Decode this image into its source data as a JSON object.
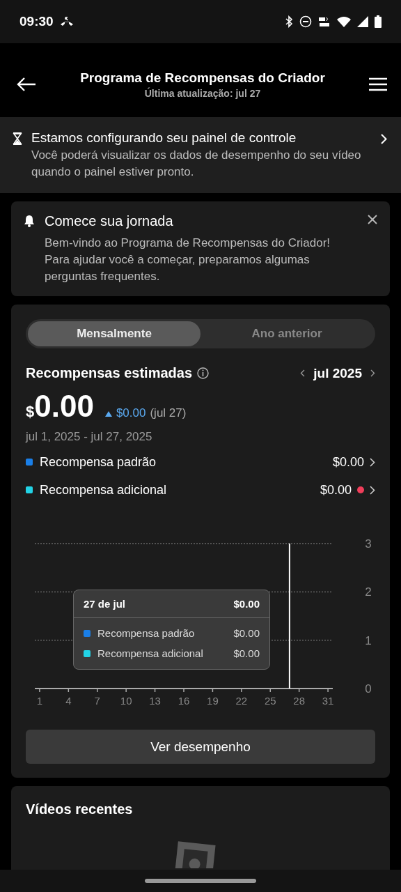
{
  "status_bar": {
    "time": "09:30"
  },
  "header": {
    "title": "Programa de Recompensas do Criador",
    "subtitle": "Última atualização: jul 27"
  },
  "setup_banner": {
    "title": "Estamos configurando seu painel de controle",
    "text": "Você poderá visualizar os dados de desempenho do seu vídeo quando o painel estiver pronto."
  },
  "journey_card": {
    "title": "Comece sua jornada",
    "text": "Bem-vindo ao Programa de Recompensas do Criador! Para ajudar você a começar, preparamos algumas perguntas frequentes."
  },
  "rewards": {
    "tabs": [
      {
        "label": "Mensalmente",
        "selected": true
      },
      {
        "label": "Ano anterior",
        "selected": false
      }
    ],
    "title": "Recompensas estimadas",
    "month": "jul 2025",
    "currency": "$",
    "amount": "0.00",
    "change": "$0.00",
    "change_date": "(jul 27)",
    "range": "jul 1, 2025 - jul 27, 2025",
    "breakdown": [
      {
        "label": "Recompensa padrão",
        "value": "$0.00",
        "color": "#1a7fe8",
        "alert": false
      },
      {
        "label": "Recompensa adicional",
        "value": "$0.00",
        "color": "#22d3e6",
        "alert": true
      }
    ],
    "chart_data": {
      "type": "line",
      "xlim": [
        0.5,
        31.5
      ],
      "ylim": [
        0,
        3
      ],
      "xticks": [
        1,
        4,
        7,
        10,
        13,
        16,
        19,
        22,
        25,
        28,
        31
      ],
      "yticks": [
        0,
        1,
        2,
        3
      ],
      "ref_lines": [
        {
          "axis": "x",
          "value": 27
        }
      ]
    },
    "tooltip": {
      "date": "27 de jul",
      "total": "$0.00",
      "rows": [
        {
          "label": "Recompensa padrão",
          "value": "$0.00",
          "color": "#1a7fe8"
        },
        {
          "label": "Recompensa adicional",
          "value": "$0.00",
          "color": "#22d3e6"
        }
      ]
    },
    "button": "Ver desempenho"
  },
  "recent_videos": {
    "title": "Vídeos recentes"
  }
}
